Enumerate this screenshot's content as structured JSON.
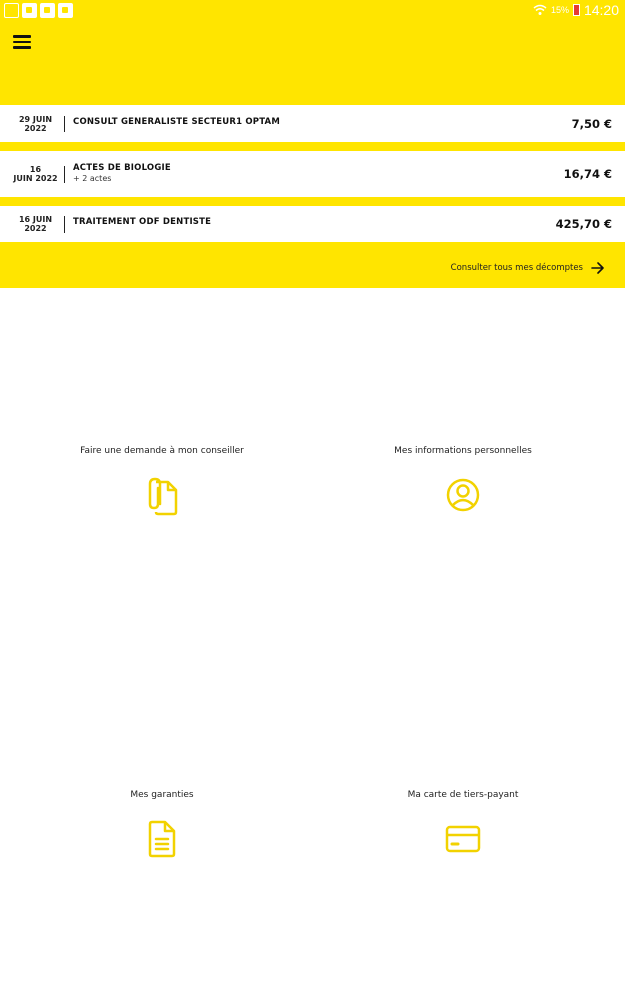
{
  "status_bar": {
    "left_icons": [
      "image-icon",
      "flipboard-icon",
      "flipboard-icon",
      "flipboard-icon"
    ],
    "signal_text": "15%",
    "time": "14:20"
  },
  "header": {
    "menu_icon": "hamburger-menu-icon"
  },
  "claims": [
    {
      "date_line1": "29 JUIN",
      "date_line2": "2022",
      "title": "CONSULT GENERALISTE SECTEUR1 OPTAM",
      "subtitle": "",
      "amount": "7,50 €"
    },
    {
      "date_line1": "16",
      "date_line2": "JUIN 2022",
      "title": "ACTES DE BIOLOGIE",
      "subtitle": "+ 2 actes",
      "amount": "16,74 €"
    },
    {
      "date_line1": "16 JUIN",
      "date_line2": "2022",
      "title": "TRAITEMENT ODF DENTISTE",
      "subtitle": "",
      "amount": "425,70 €"
    }
  ],
  "see_all": {
    "label": "Consulter tous mes décomptes"
  },
  "tiles": [
    {
      "label": "Faire une demande à mon conseiller",
      "icon": "attachment-document-icon"
    },
    {
      "label": "Mes informations personnelles",
      "icon": "user-circle-icon"
    },
    {
      "label": "Mes garanties",
      "icon": "document-lines-icon"
    },
    {
      "label": "Ma carte de tiers-payant",
      "icon": "credit-card-icon"
    }
  ],
  "colors": {
    "brand_yellow": "#ffe500",
    "text_dark": "#111111"
  }
}
